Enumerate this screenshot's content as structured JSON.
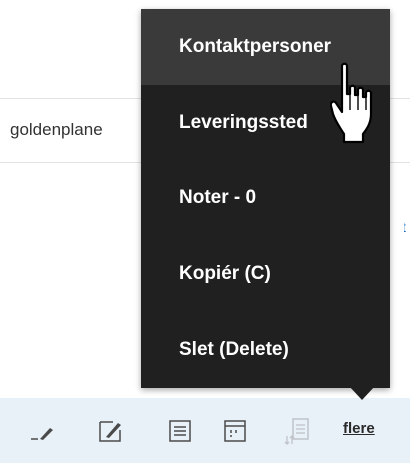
{
  "background": {
    "row_text": "goldenplane"
  },
  "menu": {
    "items": [
      {
        "label": "Kontaktpersoner"
      },
      {
        "label": "Leveringssted"
      },
      {
        "label": "Noter - 0"
      },
      {
        "label": "Kopiér (C)"
      },
      {
        "label": "Slet (Delete)"
      }
    ],
    "hovered_index": 0
  },
  "toolbar": {
    "icons": [
      {
        "name": "edit-line-icon"
      },
      {
        "name": "edit-box-icon"
      },
      {
        "name": "list-view-icon"
      },
      {
        "name": "split-view-icon"
      },
      {
        "name": "sort-list-icon",
        "disabled": true
      }
    ],
    "more_label": "flere"
  },
  "colors": {
    "menu_bg": "#202020",
    "menu_hover": "#3a3a3a",
    "menu_text": "#ffffff",
    "toolbar_bg": "#e8f0f8",
    "icon_color": "#4a4a4a"
  }
}
